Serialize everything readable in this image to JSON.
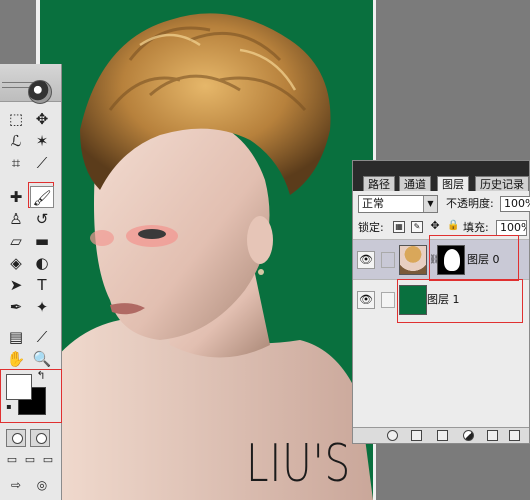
{
  "canvas": {
    "watermark": "LIU'S"
  },
  "toolbox": {
    "tools": [
      {
        "name": "marquee-tool-icon",
        "glyph": "⬚"
      },
      {
        "name": "move-tool-icon",
        "glyph": "✥"
      },
      {
        "name": "lasso-tool-icon",
        "glyph": "ℒ"
      },
      {
        "name": "magic-wand-tool-icon",
        "glyph": "✶"
      },
      {
        "name": "crop-tool-icon",
        "glyph": "⌗"
      },
      {
        "name": "slice-tool-icon",
        "glyph": "⟋"
      },
      {
        "name": "healing-brush-tool-icon",
        "glyph": "✚"
      },
      {
        "name": "brush-tool-icon",
        "glyph": "🖌"
      },
      {
        "name": "clone-stamp-tool-icon",
        "glyph": "♙"
      },
      {
        "name": "history-brush-tool-icon",
        "glyph": "↺"
      },
      {
        "name": "eraser-tool-icon",
        "glyph": "▱"
      },
      {
        "name": "gradient-tool-icon",
        "glyph": "▬"
      },
      {
        "name": "blur-tool-icon",
        "glyph": "◈"
      },
      {
        "name": "dodge-tool-icon",
        "glyph": "◐"
      },
      {
        "name": "path-selection-tool-icon",
        "glyph": "➤"
      },
      {
        "name": "type-tool-icon",
        "glyph": "T"
      },
      {
        "name": "pen-tool-icon",
        "glyph": "✒"
      },
      {
        "name": "custom-shape-tool-icon",
        "glyph": "✦"
      },
      {
        "name": "notes-tool-icon",
        "glyph": "▤"
      },
      {
        "name": "eyedropper-tool-icon",
        "glyph": "⟋"
      },
      {
        "name": "hand-tool-icon",
        "glyph": "✋"
      },
      {
        "name": "zoom-tool-icon",
        "glyph": "🔍"
      }
    ],
    "swap_glyph": "↰",
    "foreground_color": "#ffffff",
    "background_color": "#000000"
  },
  "layers_panel": {
    "tabs": [
      "路径",
      "通道",
      "图层",
      "历史记录"
    ],
    "active_tab": "图层",
    "blend_mode": "正常",
    "opacity_label": "不透明度:",
    "opacity_value": "100%",
    "lock_label": "锁定:",
    "fill_label": "填充:",
    "fill_value": "100%",
    "layers": [
      {
        "name": "图层 0",
        "visible": true,
        "has_mask": true
      },
      {
        "name": "图层 1",
        "visible": true,
        "has_mask": false,
        "fill_color": "#09703e"
      }
    ]
  },
  "colors": {
    "canvas_green": "#09703e",
    "highlight_red": "#e03030"
  }
}
